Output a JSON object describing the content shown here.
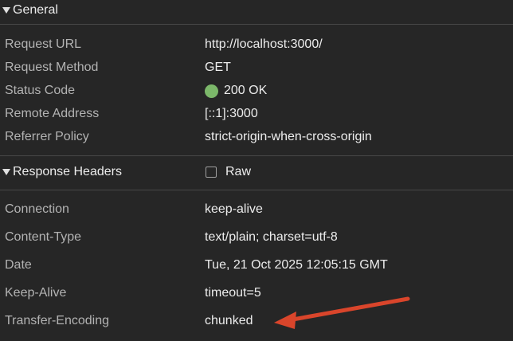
{
  "general": {
    "title": "General",
    "rows": [
      {
        "key": "Request URL",
        "value": "http://localhost:3000/"
      },
      {
        "key": "Request Method",
        "value": "GET"
      },
      {
        "key": "Status Code",
        "value": "200 OK"
      },
      {
        "key": "Remote Address",
        "value": "[::1]:3000"
      },
      {
        "key": "Referrer Policy",
        "value": "strict-origin-when-cross-origin"
      }
    ]
  },
  "response_headers": {
    "title": "Response Headers",
    "raw_label": "Raw",
    "raw_checked": false,
    "rows": [
      {
        "key": "Connection",
        "value": "keep-alive"
      },
      {
        "key": "Content-Type",
        "value": "text/plain; charset=utf-8"
      },
      {
        "key": "Date",
        "value": "Tue, 21 Oct 2025 12:05:15 GMT"
      },
      {
        "key": "Keep-Alive",
        "value": "timeout=5"
      },
      {
        "key": "Transfer-Encoding",
        "value": "chunked"
      }
    ]
  },
  "colors": {
    "status_ok": "#7cb86a",
    "annotation_arrow": "#d9452b"
  },
  "icons": {
    "collapse": "triangle-down-icon",
    "status": "status-dot-icon",
    "annotation": "red-arrow-icon"
  }
}
